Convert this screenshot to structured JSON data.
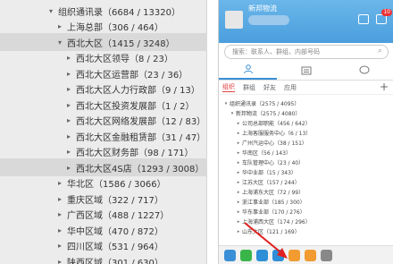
{
  "left_tree": [
    {
      "label": "组织通讯录（6684 / 13320）",
      "arrow": "▾",
      "indent": 0
    },
    {
      "label": "上海总部（306 / 464）",
      "arrow": "▸",
      "indent": 1
    },
    {
      "label": "西北大区（1415 / 3248）",
      "arrow": "▾",
      "indent": 1,
      "selected": true
    },
    {
      "label": "西北大区领导（8 / 23）",
      "arrow": "▸",
      "indent": 2
    },
    {
      "label": "西北大区运营部（23 / 36）",
      "arrow": "▸",
      "indent": 2
    },
    {
      "label": "西北大区人力行政部（9 / 13）",
      "arrow": "▸",
      "indent": 2
    },
    {
      "label": "西北大区投资发展部（1 / 2）",
      "arrow": "▸",
      "indent": 2
    },
    {
      "label": "西北大区网络发展部（12 / 83）",
      "arrow": "▸",
      "indent": 2
    },
    {
      "label": "西北大区金融租赁部（31 / 47）",
      "arrow": "▸",
      "indent": 2
    },
    {
      "label": "西北大区财务部（98 / 171）",
      "arrow": "▸",
      "indent": 2
    },
    {
      "label": "西北大区4S店（1293 / 3008）",
      "arrow": "▸",
      "indent": 2,
      "selected": true
    },
    {
      "label": "华北区（1586 / 3066）",
      "arrow": "▸",
      "indent": 1
    },
    {
      "label": "重庆区域（322 / 717）",
      "arrow": "▸",
      "indent": 1
    },
    {
      "label": "广西区域（488 / 1227）",
      "arrow": "▸",
      "indent": 1
    },
    {
      "label": "华中区域（470 / 872）",
      "arrow": "▸",
      "indent": 1
    },
    {
      "label": "四川区域（531 / 964）",
      "arrow": "▸",
      "indent": 1
    },
    {
      "label": "陕西区域（301 / 630）",
      "arrow": "▸",
      "indent": 1
    }
  ],
  "right": {
    "app_name": "新邦物流",
    "mail_badge": "10",
    "search_placeholder": "搜索：联系人、群组、内部号码",
    "quick_colors": [
      "#39b54a",
      "#2d8fd8",
      "#f29b30",
      "#f0c030"
    ],
    "tabs": [
      "",
      "",
      ""
    ],
    "subtabs": [
      {
        "label": "组织",
        "active": true
      },
      {
        "label": "群组",
        "active": false
      },
      {
        "label": "好友",
        "active": false
      },
      {
        "label": "应用",
        "active": false
      }
    ],
    "tree": [
      {
        "label": "组织通讯录（2575 / 4095）",
        "arrow": "▾",
        "indent": 0
      },
      {
        "label": "新邦物流（2575 / 4080）",
        "arrow": "▾",
        "indent": 1
      },
      {
        "label": "公司总部职能（456 / 642）",
        "arrow": "▸",
        "indent": 2
      },
      {
        "label": "上海客服服务中心（6 / 13）",
        "arrow": "▸",
        "indent": 2
      },
      {
        "label": "广州汽运中心（38 / 151）",
        "arrow": "▸",
        "indent": 2
      },
      {
        "label": "华南区（56 / 143）",
        "arrow": "▸",
        "indent": 2
      },
      {
        "label": "车队管理中心（23 / 40）",
        "arrow": "▸",
        "indent": 2
      },
      {
        "label": "华中业部（15 / 343）",
        "arrow": "▸",
        "indent": 2
      },
      {
        "label": "江苏大区（157 / 244）",
        "arrow": "▸",
        "indent": 2
      },
      {
        "label": "上海浦东大区（72 / 99）",
        "arrow": "▸",
        "indent": 2
      },
      {
        "label": "浙江事业部（185 / 300）",
        "arrow": "▸",
        "indent": 2
      },
      {
        "label": "华东事业部（170 / 276）",
        "arrow": "▸",
        "indent": 2
      },
      {
        "label": "上海浦西大区（174 / 296）",
        "arrow": "▸",
        "indent": 2
      },
      {
        "label": "山东大区（121 / 169）",
        "arrow": "▸",
        "indent": 2
      }
    ],
    "bottom_colors": [
      "#3a8fd6",
      "#39b54a",
      "#2d8fd8",
      "#2d8fd8",
      "#f29b30",
      "#f29b30",
      "#888888"
    ]
  },
  "colors": {
    "accent": "#3a8fd6",
    "header_top": "#6bb6ea",
    "header_bottom": "#4a9fdd",
    "active_subtab": "#e04040",
    "arrow_red": "#e02020"
  }
}
